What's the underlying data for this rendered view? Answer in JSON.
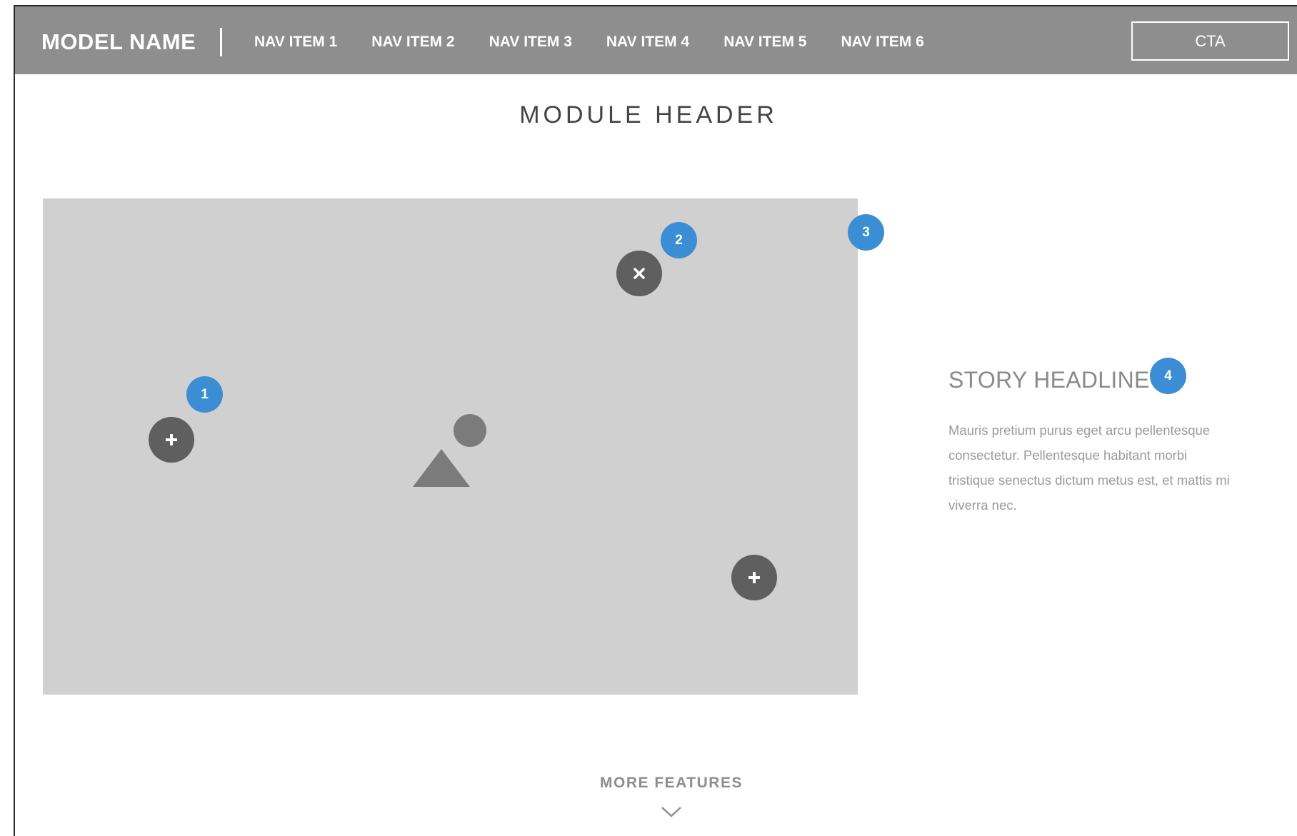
{
  "header": {
    "model_name": "MODEL NAME",
    "nav_items": [
      {
        "label": "NAV ITEM 1"
      },
      {
        "label": "NAV ITEM 2"
      },
      {
        "label": "NAV ITEM 3"
      },
      {
        "label": "NAV ITEM 4"
      },
      {
        "label": "NAV ITEM 5"
      },
      {
        "label": "NAV ITEM 6"
      }
    ],
    "cta_label": "CTA"
  },
  "module": {
    "header": "MODULE HEADER"
  },
  "image": {
    "hotspots": [
      {
        "icon": "plus-icon"
      },
      {
        "icon": "close-icon"
      },
      {
        "icon": "plus-icon"
      }
    ],
    "badges": [
      "1",
      "2",
      "3"
    ]
  },
  "story": {
    "headline": "STORY HEADLINE",
    "badge": "4",
    "body": "Mauris pretium purus eget arcu pellentesque consectetur. Pellentesque habitant morbi tristique senectus dictum metus est, et mattis mi viverra nec."
  },
  "footer": {
    "more_features": "MORE FEATURES",
    "chevron_icon": "chevron-down-icon"
  },
  "colors": {
    "nav_bg": "#8f8e8f",
    "badge": "#3b8ed3",
    "hotspot": "#5f5f5f",
    "image_bg": "#d0d0d0"
  }
}
